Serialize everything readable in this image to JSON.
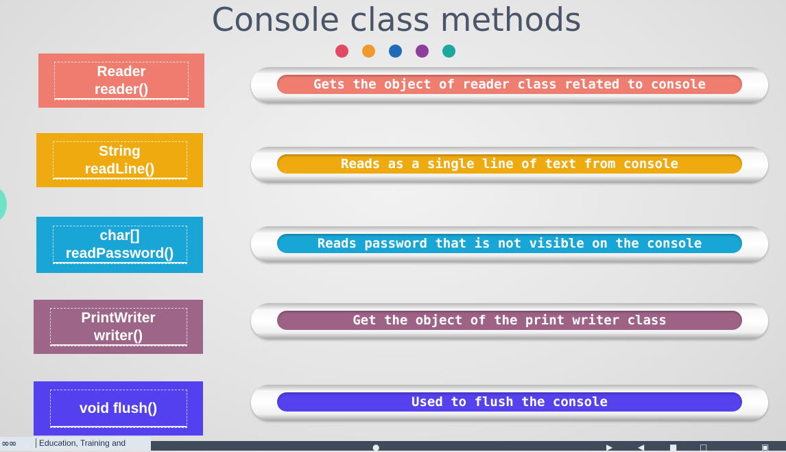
{
  "title": "Console class methods",
  "dot_colors": [
    "#e04a62",
    "#ee9a2c",
    "#1c6cb8",
    "#8e3f9c",
    "#1aa99c"
  ],
  "methods": [
    {
      "return_type": "Reader",
      "name": "reader()",
      "description": "Gets the object of reader class related to console",
      "box_color": "#ee7d70",
      "bar_color": "#ef7e70"
    },
    {
      "return_type": "String",
      "name": "readLine()",
      "description": "Reads as a single line of text from console",
      "box_color": "#eeaa0e",
      "bar_color": "#efaa10"
    },
    {
      "return_type": "char[]",
      "name": "readPassword()",
      "description": "Reads password that is not visible on the console",
      "box_color": "#19a6d6",
      "bar_color": "#18a6d6"
    },
    {
      "return_type": "PrintWriter",
      "name": "writer()",
      "description": "Get the object of the print writer class",
      "box_color": "#9d6588",
      "bar_color": "#9d6286"
    },
    {
      "return_type": "",
      "name": "void flush()",
      "description": "Used to flush the console",
      "box_color": "#5341ef",
      "bar_color": "#5541ee"
    }
  ],
  "footer": {
    "logo_text": "Education, Training and",
    "controls": [
      "back-icon",
      "undo-icon",
      "redo-icon",
      "pointer-icon",
      "volume-icon",
      "speaker-icon",
      "captions-icon",
      "screen-icon",
      "fullscreen-icon"
    ]
  }
}
